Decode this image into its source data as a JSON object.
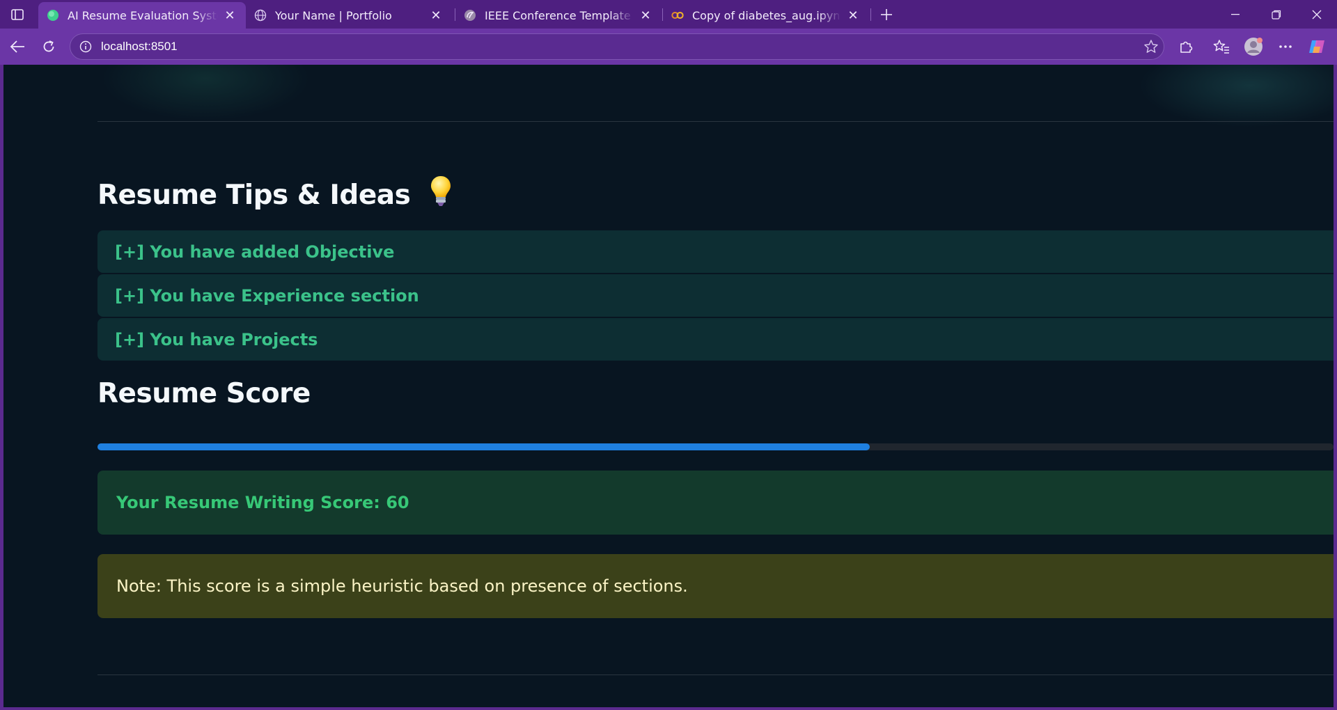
{
  "browser": {
    "tabs": [
      {
        "title": "AI Resume Evaluation System",
        "icon": "streamlit-favicon",
        "active": true
      },
      {
        "title": "Your Name | Portfolio",
        "icon": "globe-icon",
        "active": false
      },
      {
        "title": "IEEE Conference Template - Online LaTeX Editor Overleaf",
        "icon": "overleaf-icon",
        "active": false
      },
      {
        "title": "Copy of diabetes_aug.ipynb - Colab",
        "icon": "colab-icon",
        "active": false
      }
    ],
    "address": "localhost:8501",
    "colors": {
      "frame": "#5b2a8e",
      "toolbar": "#6b36a6",
      "active_tab": "#6b36a6"
    }
  },
  "page": {
    "tips_heading": "Resume Tips & Ideas",
    "tips_heading_icon": "lightbulb-icon",
    "tips": [
      "[+] You have added Objective",
      "[+] You have Experience section",
      "[+] You have Projects"
    ],
    "score_heading": "Resume Score",
    "score_progress": 0.625,
    "score_message": "Your Resume Writing Score: 60",
    "note": "Note: This score is a simple heuristic based on presence of sections.",
    "colors": {
      "background": "#081521",
      "tip_text": "#3bc28a",
      "progress": "#1f80e0",
      "success_bg": "#133a2c",
      "success_text": "#37c877",
      "warning_bg": "#3b4119",
      "warning_text": "#fbf4c6"
    }
  }
}
